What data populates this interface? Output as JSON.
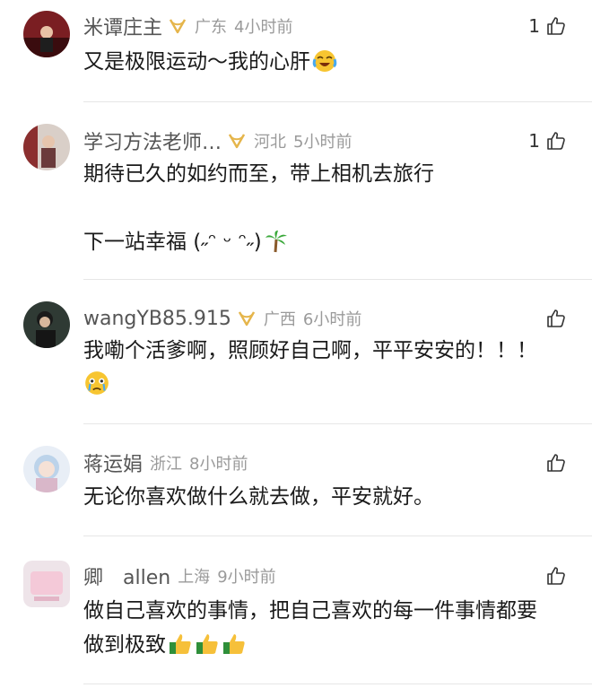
{
  "comments": [
    {
      "name": "米谭庄主",
      "region": "广东",
      "time": "4小时前",
      "likes": "1",
      "lines": [
        "又是极限运动～我的心肝"
      ]
    },
    {
      "name": "学习方法老师…",
      "region": "河北",
      "time": "5小时前",
      "likes": "1",
      "lines": [
        "期待已久的如约而至，带上相机去旅行",
        "下一站幸福 (˶ᵔ ᵕ ᵔ˶)"
      ]
    },
    {
      "name": "wangYB85.915",
      "region": "广西",
      "time": "6小时前",
      "likes": "",
      "lines": [
        "我嘞个活爹啊，照顾好自己啊，平平安安的！！！"
      ]
    },
    {
      "name": "蒋运娟",
      "region": "浙江",
      "time": "8小时前",
      "likes": "",
      "lines": [
        "无论你喜欢做什么就去做，平安就好。"
      ]
    },
    {
      "name": "卿　allen",
      "region": "上海",
      "time": "9小时前",
      "likes": "",
      "lines": [
        "做自己喜欢的事情，把自己喜欢的每一件事情都要",
        "做到极致"
      ]
    }
  ],
  "colors": {
    "vip": "#e5b54b",
    "meta": "#9a9a9a",
    "name": "#555555"
  },
  "icons": {
    "like": "thumbs-up-outline-icon",
    "vip": "vip-badge-icon"
  }
}
